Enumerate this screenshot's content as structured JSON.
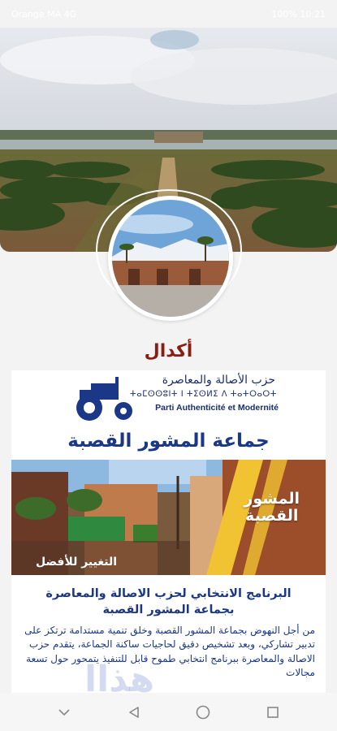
{
  "status_bar": {
    "left": "Orange MA 4G",
    "right": "100% 10:21"
  },
  "hero": {
    "image": "palm-grove-basin-landscape"
  },
  "avatar": {
    "image": "kasbah-mechouar-snow-mountains"
  },
  "page": {
    "title": "أكدال"
  },
  "poster": {
    "party_name_ar": "حزب الأصالة والمعاصرة",
    "party_name_amazigh": "ⵜⴰⵎⵙⵙⵓⵏⵜ ⵏ ⵜⵉⵙⵍⵉ ⴷ ⵜⴰⵜⵔⴰⵔⵜ",
    "party_name_fr": "Parti Authenticité et Modernité",
    "commune": "جماعة المشور القصبة",
    "photo_label_line1": "المشور",
    "photo_label_line2": "القصبة",
    "slogan": "التغيير للأفضل",
    "program_title_line1": "البرنامج الانتخابي لحزب الاصالة والمعاصرة",
    "program_title_line2": "بجماعة المشور القصبة",
    "program_text": "من أجل النهوض بجماعة المشور القصبة وخلق تنمية مستدامة ترتكز على تدبير تشاركي، وبعد تشخيص دقيق لحاجيات ساكنة الجماعة، يتقدم حزب الاصالة والمعاصرة ببرنامج انتخابي طموح قابل للتنفيذ يتمحور حول تسعة مجالات"
  },
  "colors": {
    "title": "#8a1d12",
    "party_blue": "#1b3787"
  },
  "nav": {
    "icons": [
      "chevron-down-icon",
      "back-triangle-icon",
      "home-circle-icon",
      "recents-square-icon"
    ]
  }
}
